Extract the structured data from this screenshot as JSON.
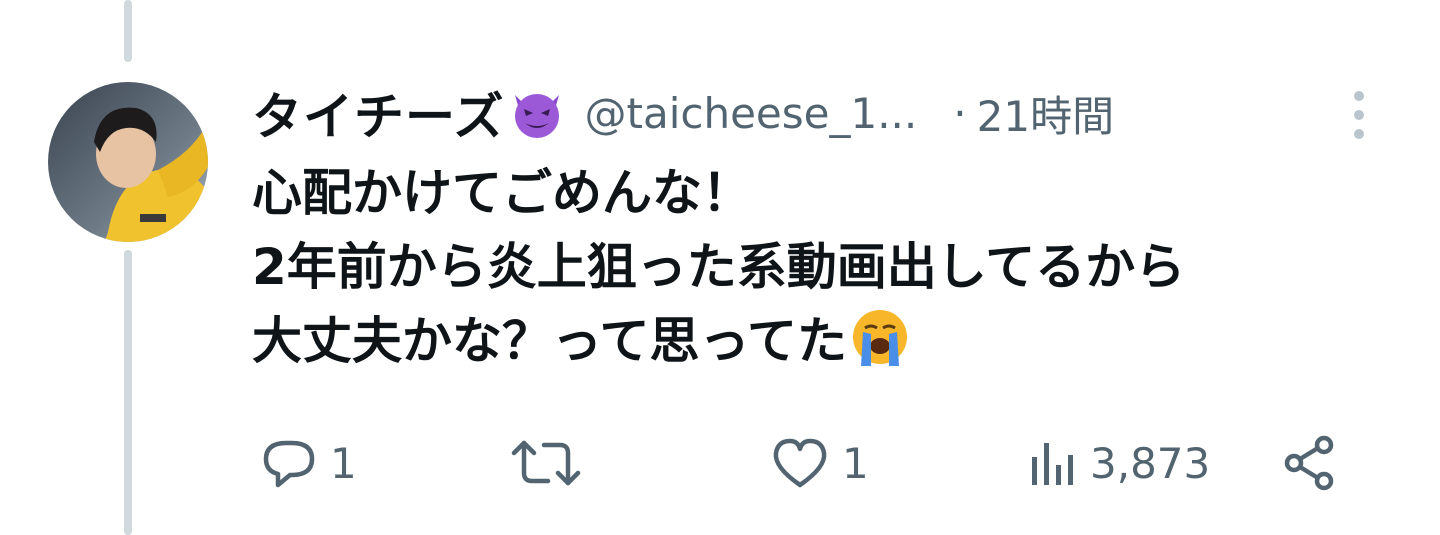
{
  "tweet": {
    "display_name": "タイチーズ",
    "name_emoji": "smiling-imp-emoji",
    "handle": "@taicheese_1...",
    "time_separator": "·",
    "timestamp": "21時間",
    "text_lines": [
      "心配かけてごめんな！",
      "2年前から炎上狙った系動画出してるから",
      "大丈夫かな？って思ってた"
    ],
    "text_end_emoji": "loudly-crying-face-emoji"
  },
  "actions": {
    "reply_count": "1",
    "retweet_count": "",
    "like_count": "1",
    "views_count": "3,873"
  },
  "colors": {
    "text_primary": "#0f1419",
    "text_secondary": "#536471",
    "thread_line": "#cfd9de",
    "background": "#ffffff"
  }
}
